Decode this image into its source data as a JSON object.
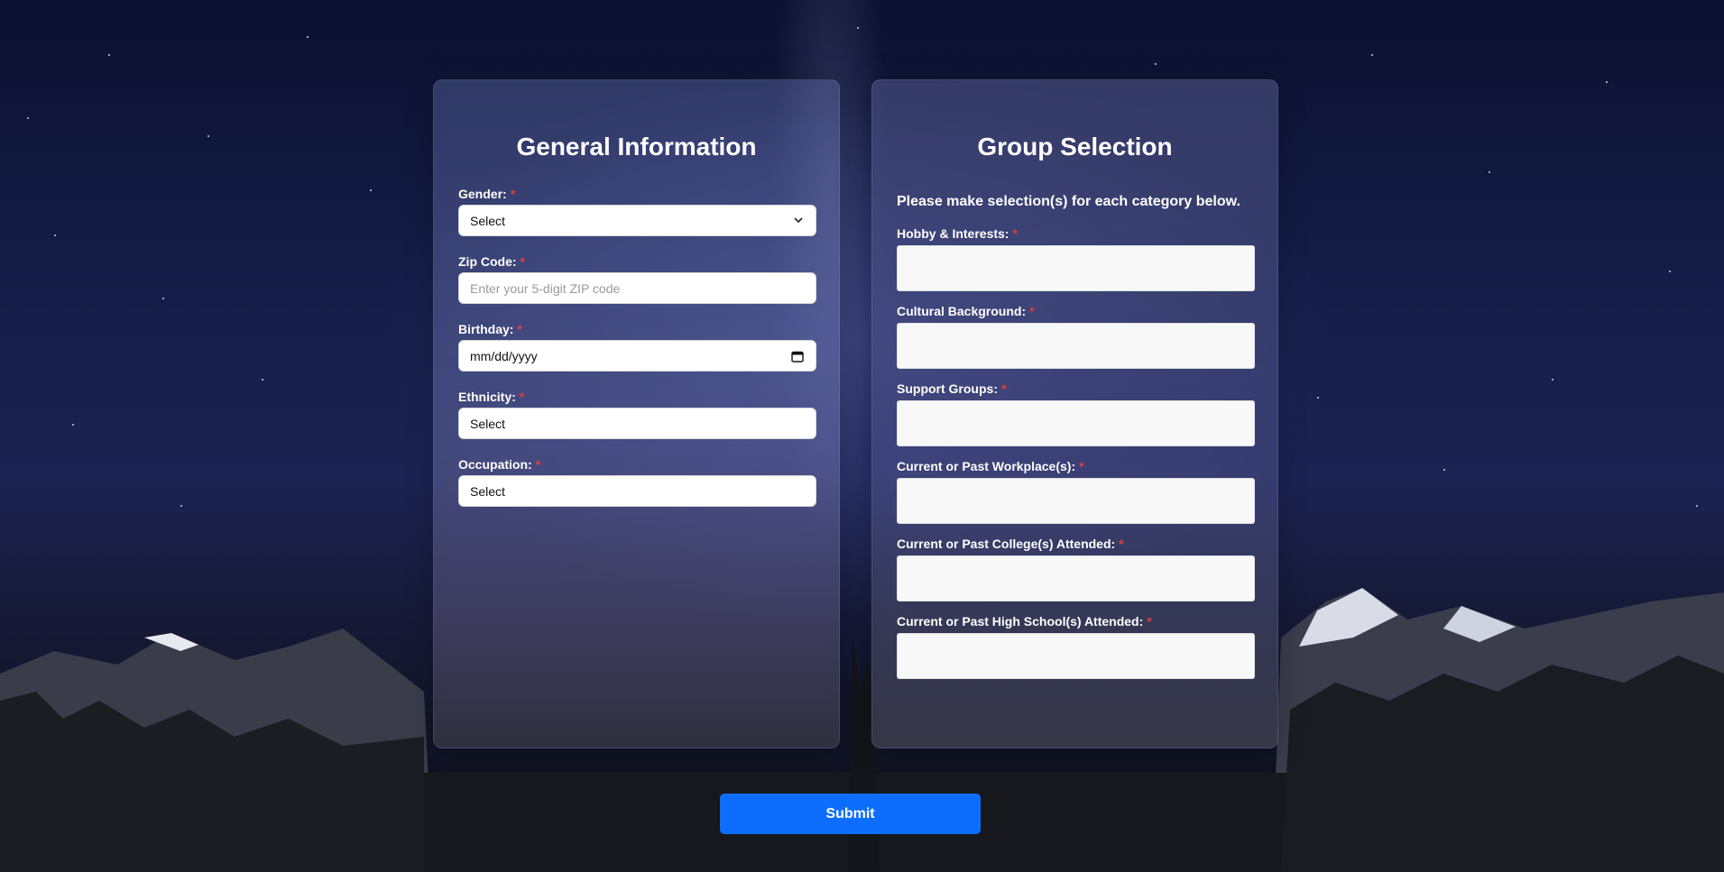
{
  "general": {
    "title": "General Information",
    "required_mark": "*",
    "gender": {
      "label": "Gender:",
      "value": "Select"
    },
    "zip": {
      "label": "Zip Code:",
      "placeholder": "Enter your 5-digit ZIP code"
    },
    "birthday": {
      "label": "Birthday:",
      "value": "mm/dd/yyyy"
    },
    "ethnicity": {
      "label": "Ethnicity:",
      "value": "Select"
    },
    "occupation": {
      "label": "Occupation:",
      "value": "Select"
    }
  },
  "groups": {
    "title": "Group Selection",
    "instructions": "Please make selection(s) for each category below.",
    "required_mark": "*",
    "fields": [
      {
        "label": "Hobby & Interests:"
      },
      {
        "label": "Cultural Background:"
      },
      {
        "label": "Support Groups:"
      },
      {
        "label": "Current or Past Workplace(s):"
      },
      {
        "label": "Current or Past College(s) Attended:"
      },
      {
        "label": "Current or Past High School(s) Attended:"
      }
    ]
  },
  "submit": {
    "label": "Submit"
  },
  "colors": {
    "accent": "#0d6efd",
    "required": "#e33c3c"
  }
}
